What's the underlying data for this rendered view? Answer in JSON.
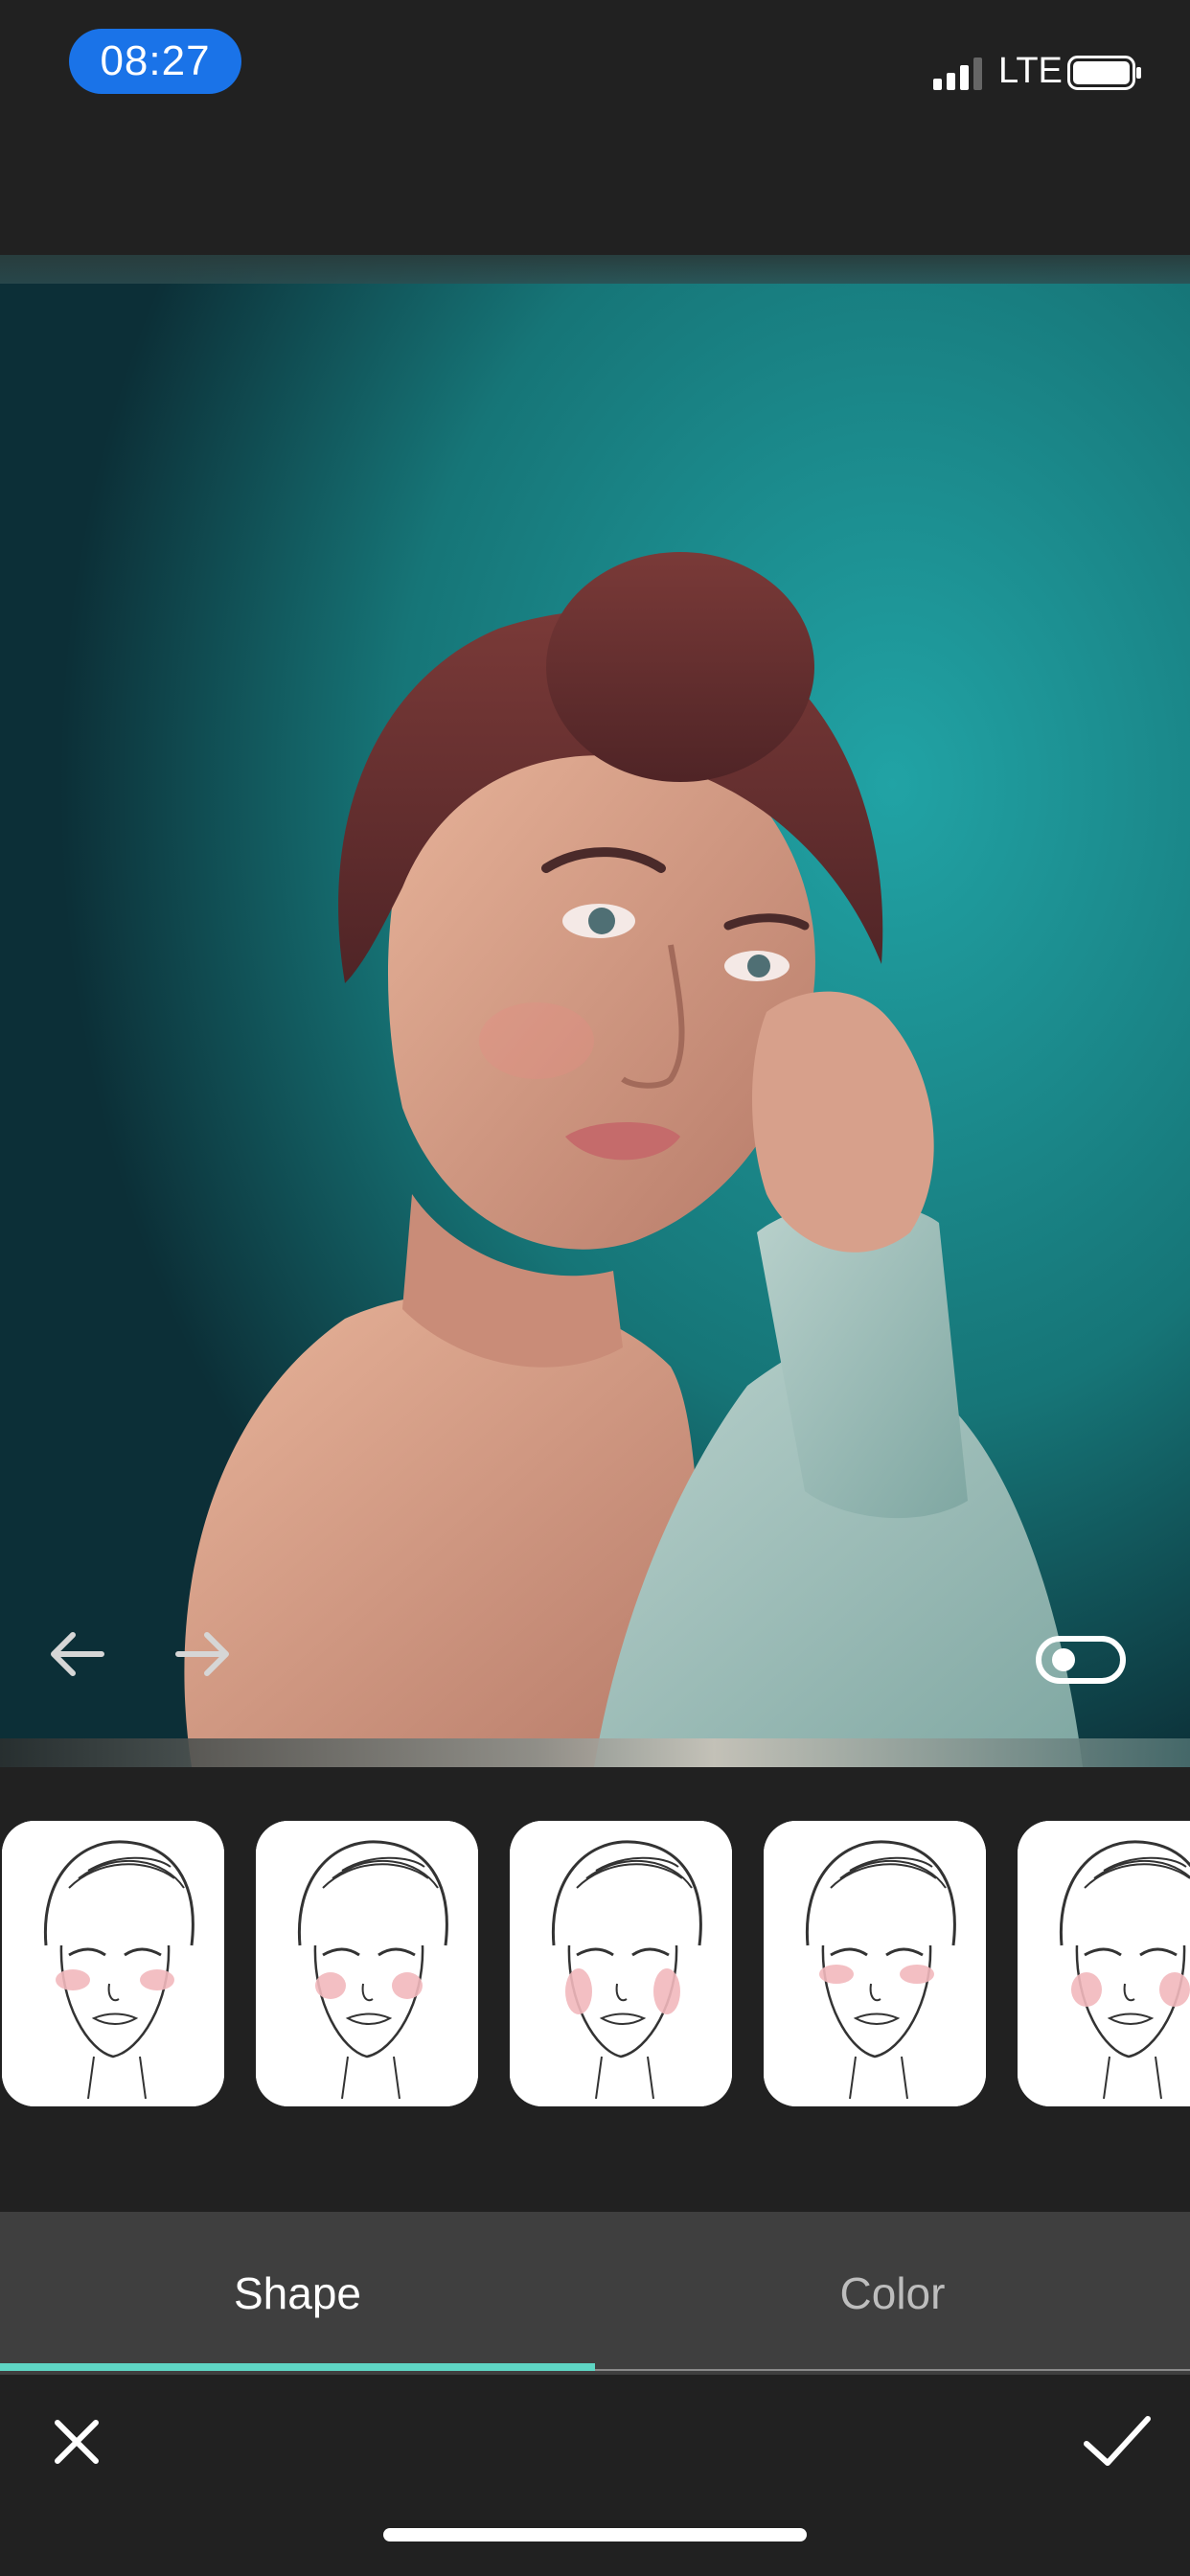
{
  "status_bar": {
    "time": "08:27",
    "network": "LTE",
    "icons": [
      "signal-icon",
      "battery-icon"
    ]
  },
  "photo": {
    "description_icon": "portrait-photo",
    "nav_icons": [
      "arrow-left-icon",
      "arrow-right-icon"
    ],
    "compare_toggle_icon": "toggle-icon"
  },
  "thumbnails": {
    "count_visible": 5,
    "icon": "face-blush-icon"
  },
  "tabs": {
    "shape_label": "Shape",
    "color_label": "Color",
    "active": "Shape",
    "accent": "#5fd6c4"
  },
  "actions": {
    "cancel_icon": "close-icon",
    "confirm_icon": "check-icon"
  },
  "colors": {
    "background": "#212121",
    "time_pill": "#1a73e8",
    "tab_bar": "#3f3f3f"
  }
}
